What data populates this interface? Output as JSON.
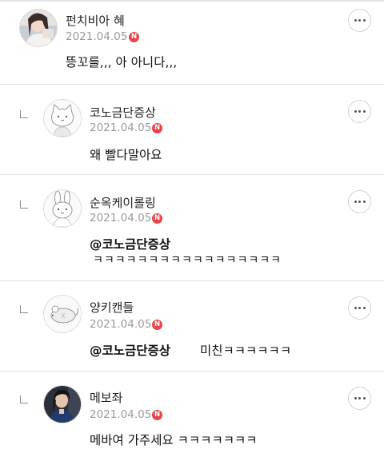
{
  "comments": [
    {
      "author": "펀치비아 혜",
      "date": "2021.04.05",
      "badge": "N",
      "text": "뜽꼬를,,, 아 아니다,,,",
      "avatar_icon": "profile-photo",
      "is_reply": false
    },
    {
      "author": "코노금단증상",
      "date": "2021.04.05",
      "badge": "N",
      "text": "왜 빨다말아요",
      "avatar_icon": "cat-default-avatar-icon",
      "is_reply": true
    },
    {
      "author": "순옥케이롤링",
      "date": "2021.04.05",
      "badge": "N",
      "mention": "@코노금단증상",
      "text": "ㅋㅋㅋㅋㅋㅋㅋㅋㅋㅋㅋㅋㅋㅋㅋㅋㅋ",
      "avatar_icon": "rabbit-default-avatar-icon",
      "is_reply": true
    },
    {
      "author": "양키캔들",
      "date": "2021.04.05",
      "badge": "N",
      "mention": "@코노금단증상",
      "text": "미친ㅋㅋㅋㅋㅋㅋ",
      "avatar_icon": "mouse-default-avatar-icon",
      "is_reply": true
    },
    {
      "author": "메보좌",
      "date": "2021.04.05",
      "badge": "N",
      "text": "메바여 가주세요 ㅋㅋㅋㅋㅋㅋㅋ",
      "avatar_icon": "profile-photo",
      "is_reply": true
    }
  ],
  "colors": {
    "badge": "#e8454a",
    "date": "#9a9a9a",
    "separator": "#e2e2e2"
  }
}
